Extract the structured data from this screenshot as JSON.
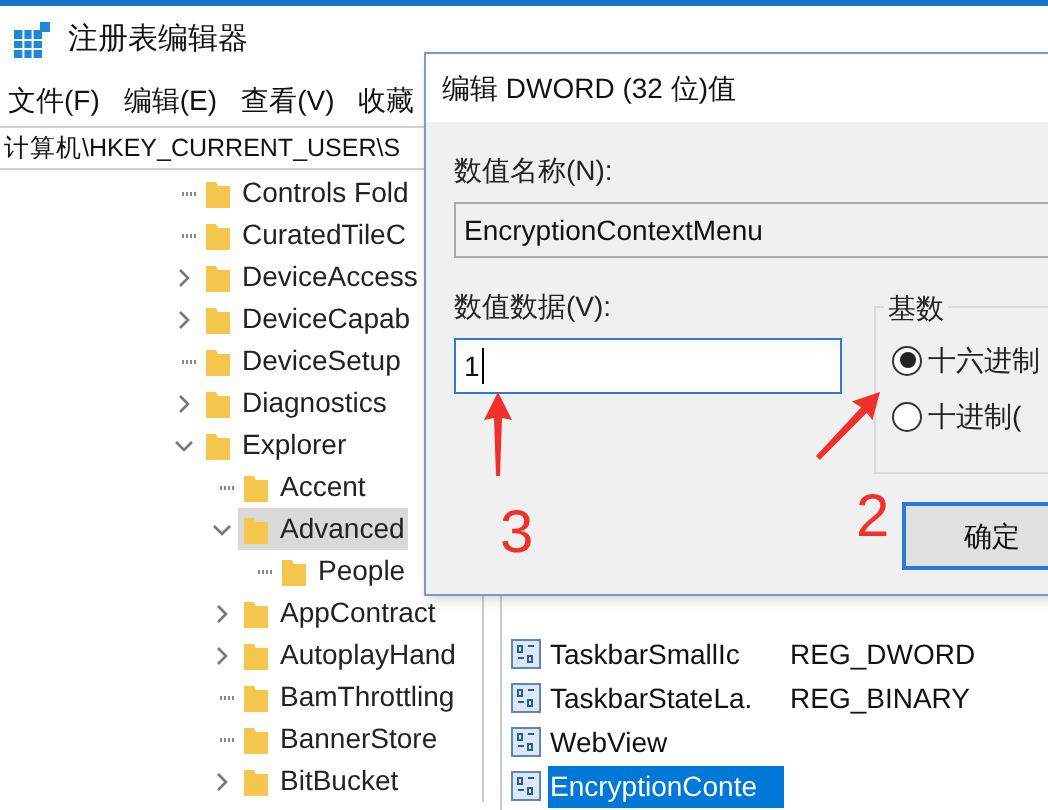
{
  "window": {
    "title": "注册表编辑器"
  },
  "menu": [
    {
      "label": "文件(F)"
    },
    {
      "label": "编辑(E)"
    },
    {
      "label": "查看(V)"
    },
    {
      "label": "收藏"
    }
  ],
  "address": "计算机\\HKEY_CURRENT_USER\\S",
  "tree": [
    {
      "label": "Controls Fold",
      "kind": "leaf",
      "selected": false
    },
    {
      "label": "CuratedTileC",
      "kind": "leaf",
      "selected": false
    },
    {
      "label": "DeviceAccess",
      "kind": "branch",
      "expanded": false,
      "selected": false
    },
    {
      "label": "DeviceCapab",
      "kind": "branch",
      "expanded": false,
      "selected": false
    },
    {
      "label": "DeviceSetup",
      "kind": "leaf",
      "selected": false
    },
    {
      "label": "Diagnostics",
      "kind": "branch",
      "expanded": false,
      "selected": false
    },
    {
      "label": "Explorer",
      "kind": "branch",
      "expanded": true,
      "selected": false,
      "children": [
        {
          "label": "Accent",
          "kind": "leaf",
          "selected": false
        },
        {
          "label": "Advanced",
          "kind": "branch",
          "expanded": true,
          "selected": true,
          "children": [
            {
              "label": "People",
              "kind": "leaf",
              "selected": false
            }
          ]
        },
        {
          "label": "AppContract",
          "kind": "branch",
          "expanded": false,
          "selected": false
        },
        {
          "label": "AutoplayHand",
          "kind": "branch",
          "expanded": false,
          "selected": false
        },
        {
          "label": "BamThrottling",
          "kind": "leaf",
          "selected": false
        },
        {
          "label": "BannerStore",
          "kind": "leaf",
          "selected": false
        },
        {
          "label": "BitBucket",
          "kind": "branch",
          "expanded": false,
          "selected": false
        }
      ]
    }
  ],
  "values": [
    {
      "name": "TaskbarSmallIc",
      "type": "REG_DWORD",
      "selected": false
    },
    {
      "name": "TaskbarStateLa.",
      "type": "REG_BINARY",
      "selected": false
    },
    {
      "name": "WebView",
      "selected": false
    },
    {
      "name": "EncryptionConte",
      "selected": true
    }
  ],
  "dialog": {
    "title": "编辑 DWORD (32 位)值",
    "name_label": "数值名称(N):",
    "name_value": "EncryptionContextMenu",
    "data_label": "数值数据(V):",
    "data_value": "1",
    "base": {
      "title": "基数",
      "options": [
        {
          "label": "十六进制",
          "selected": true
        },
        {
          "label": "十进制(",
          "selected": false
        }
      ]
    },
    "ok_button": "确定"
  },
  "annotations": [
    {
      "label": "3"
    },
    {
      "label": "2"
    }
  ]
}
